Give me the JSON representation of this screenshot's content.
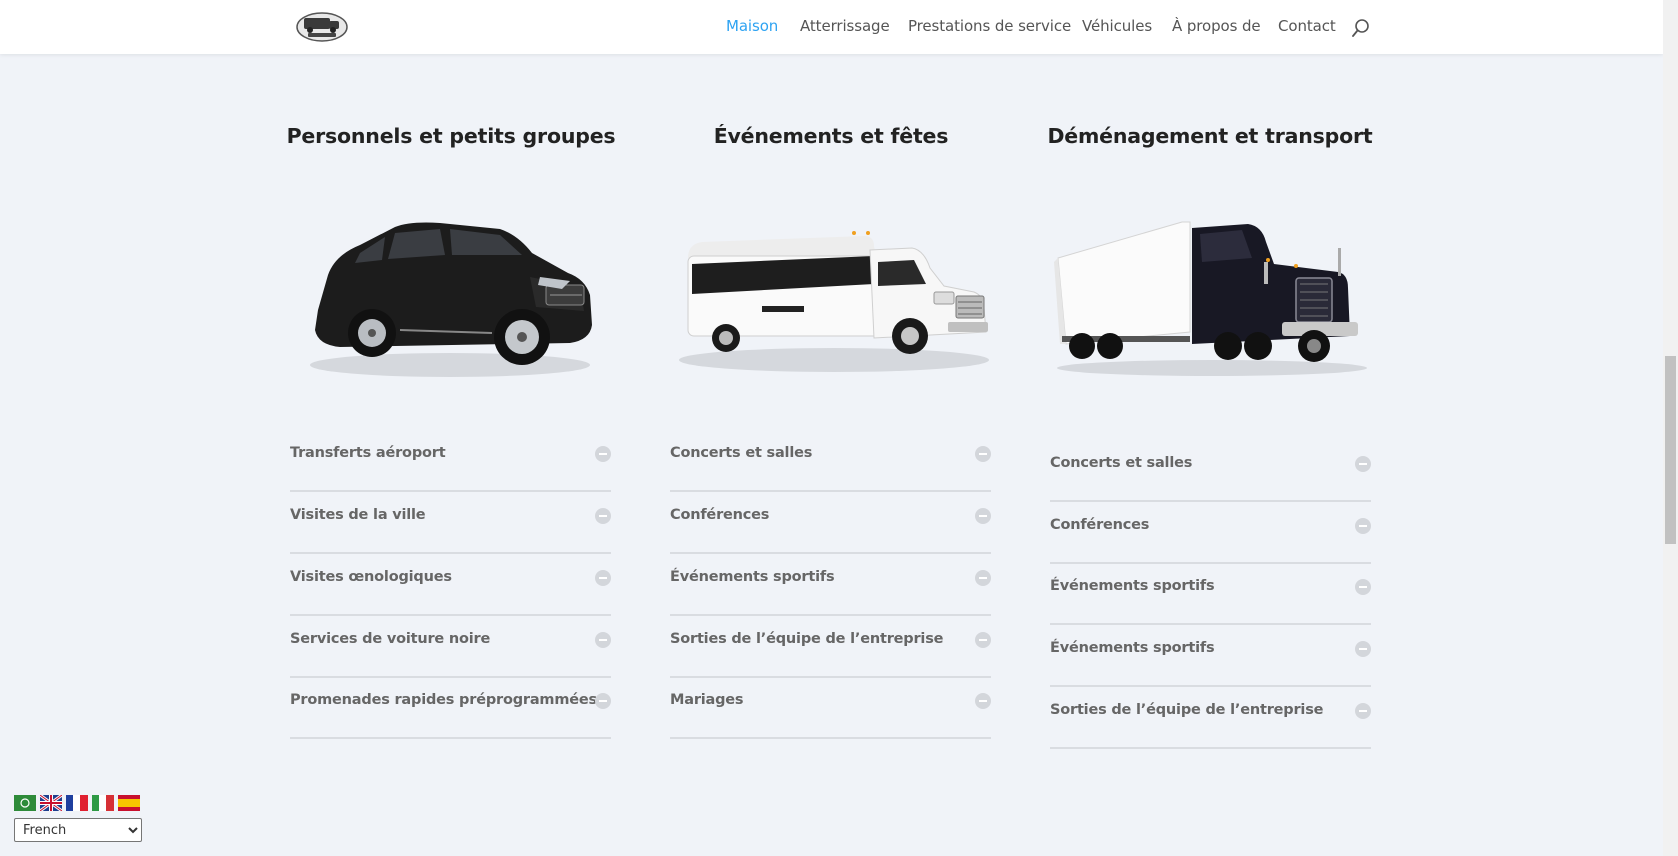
{
  "header": {
    "nav": [
      {
        "label": "Maison",
        "active": true
      },
      {
        "label": "Atterrissage",
        "active": false
      },
      {
        "label": "Prestations de service",
        "active": false
      },
      {
        "label": "Véhicules",
        "active": false
      },
      {
        "label": "À propos de",
        "active": false
      },
      {
        "label": "Contact",
        "active": false
      }
    ],
    "accent_color": "#2ea3f2"
  },
  "columns": [
    {
      "title": "Personnels et petits groupes",
      "vehicle_icon": "suv-icon",
      "items": [
        "Transferts aéroport",
        "Visites de la ville",
        "Visites œnologiques",
        "Services de voiture noire",
        "Promenades rapides préprogrammées"
      ]
    },
    {
      "title": "Événements et fêtes",
      "vehicle_icon": "party-bus-icon",
      "items": [
        "Concerts et salles",
        "Conférences",
        "Événements sportifs",
        "Sorties de l’équipe de l’entreprise",
        "Mariages"
      ]
    },
    {
      "title": "Déménagement et transport",
      "vehicle_icon": "truck-icon",
      "items": [
        "Concerts et salles",
        "Conférences",
        "Événements sportifs",
        "Événements sportifs",
        "Sorties de l’équipe de l’entreprise"
      ]
    }
  ],
  "language": {
    "flags": [
      "arabic-flag",
      "uk-flag",
      "france-flag",
      "italy-flag",
      "spain-flag"
    ],
    "selected": "French"
  }
}
